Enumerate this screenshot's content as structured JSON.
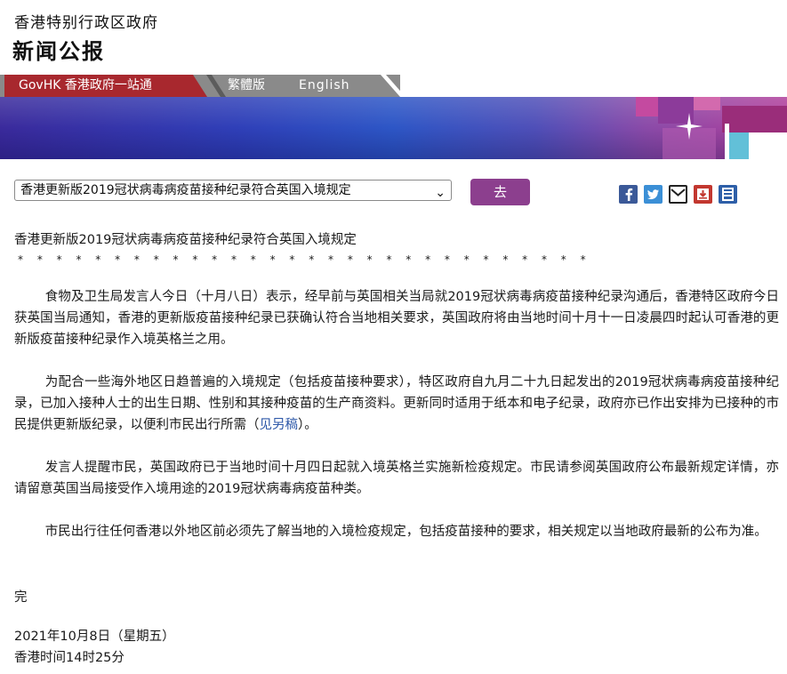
{
  "header": {
    "org_name": "香港特别行政区政府",
    "title": "新闻公报"
  },
  "nav": {
    "gov_link": "GovHK 香港政府一站通",
    "traditional": "繁體版",
    "english": "English"
  },
  "toolbar": {
    "select_value": "香港更新版2019冠状病毒病疫苗接种纪录符合英国入境规定",
    "go_label": "去",
    "share_icons": [
      "facebook-icon",
      "twitter-icon",
      "mail-icon",
      "save-icon",
      "print-icon"
    ]
  },
  "article": {
    "title": "香港更新版2019冠状病毒病疫苗接种纪录符合英国入境规定",
    "separator": "* * * * * * * * * * * * * * * * * * * * * * * * * * * * * *",
    "paragraphs": [
      "食物及卫生局发言人今日（十月八日）表示，经早前与英国相关当局就2019冠状病毒病疫苗接种纪录沟通后，香港特区政府今日获英国当局通知，香港的更新版疫苗接种纪录已获确认符合当地相关要求，英国政府将由当地时间十月十一日凌晨四时起认可香港的更新版疫苗接种纪录作入境英格兰之用。",
      "为配合一些海外地区日趋普遍的入境规定（包括疫苗接种要求），特区政府自九月二十九日起发出的2019冠状病毒病疫苗接种纪录，已加入接种人士的出生日期、性别和其接种疫苗的生产商资料。更新同时适用于纸本和电子纪录，政府亦已作出安排为已接种的市民提供更新版纪录，以便利市民出行所需（",
      "发言人提醒市民，英国政府已于当地时间十月四日起就入境英格兰实施新检疫规定。市民请参阅英国政府公布最新规定详情，亦请留意英国当局接受作入境用途的2019冠状病毒病疫苗种类。",
      "市民出行往任何香港以外地区前必须先了解当地的入境检疫规定，包括疫苗接种的要求，相关规定以当地政府最新的公布为准。"
    ],
    "p2_link": "见另稿",
    "p2_tail": "）。",
    "end_mark": "完",
    "date": "2021年10月8日（星期五）",
    "time": "香港时间14时25分"
  },
  "colors": {
    "nav_red": "#a8282e",
    "nav_grey": "#8a8a8a",
    "go_purple": "#8c3f8e",
    "link_blue": "#2c57a8"
  }
}
